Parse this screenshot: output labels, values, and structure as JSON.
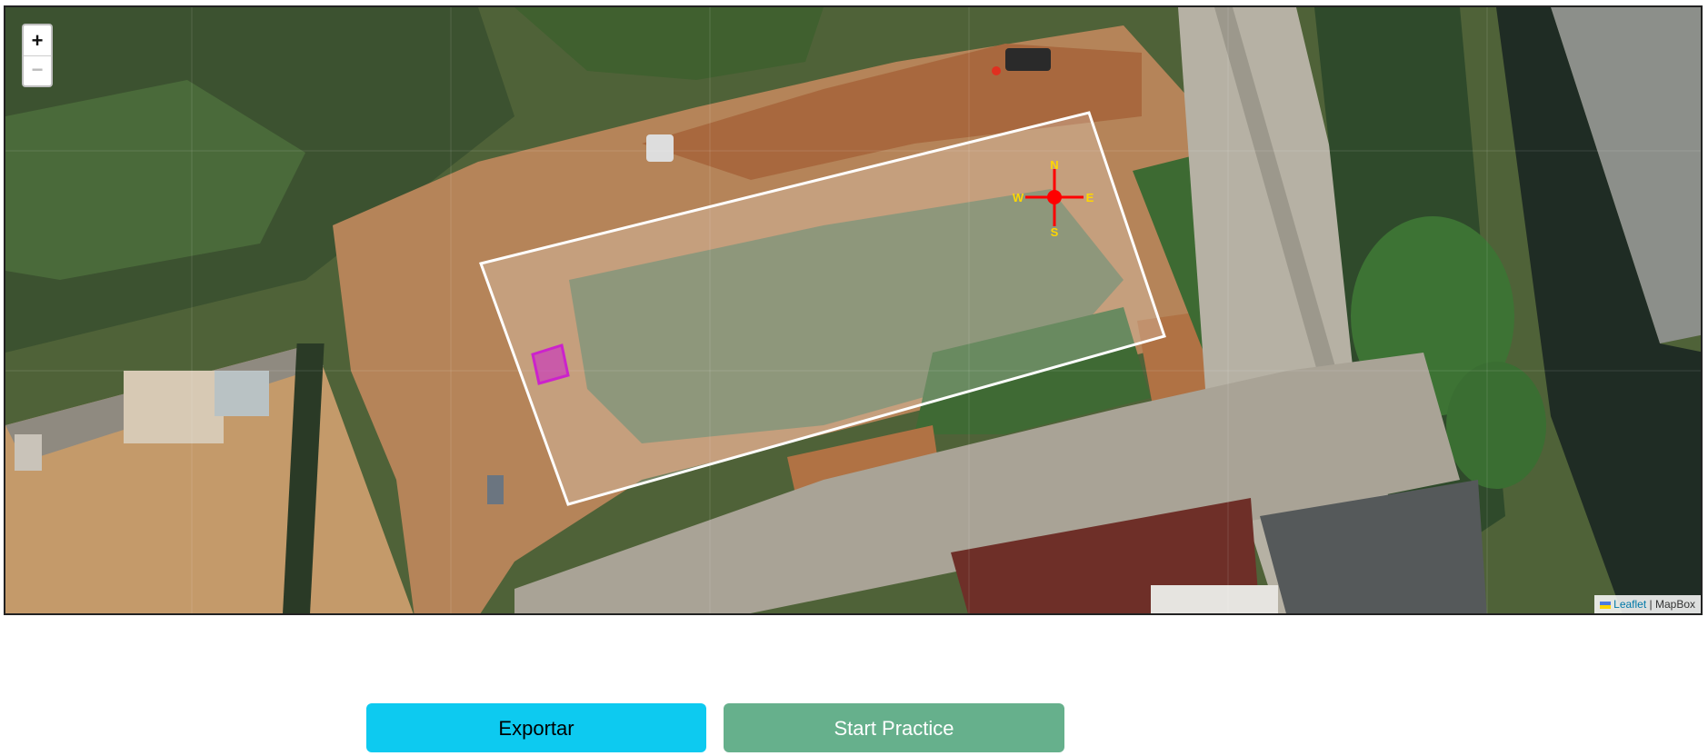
{
  "map": {
    "zoom_in_label": "+",
    "zoom_out_label": "−",
    "attribution": {
      "leaflet_label": "Leaflet",
      "separator": " | ",
      "provider_label": "MapBox"
    },
    "compass": {
      "north": "N",
      "south": "S",
      "east": "E",
      "west": "W"
    },
    "colors": {
      "field_outline": "#ffffff",
      "marker": "#cc22cc",
      "compass": "#ff0000",
      "compass_text": "#ffd700"
    }
  },
  "buttons": {
    "export_label": "Exportar",
    "practice_label": "Start Practice"
  }
}
